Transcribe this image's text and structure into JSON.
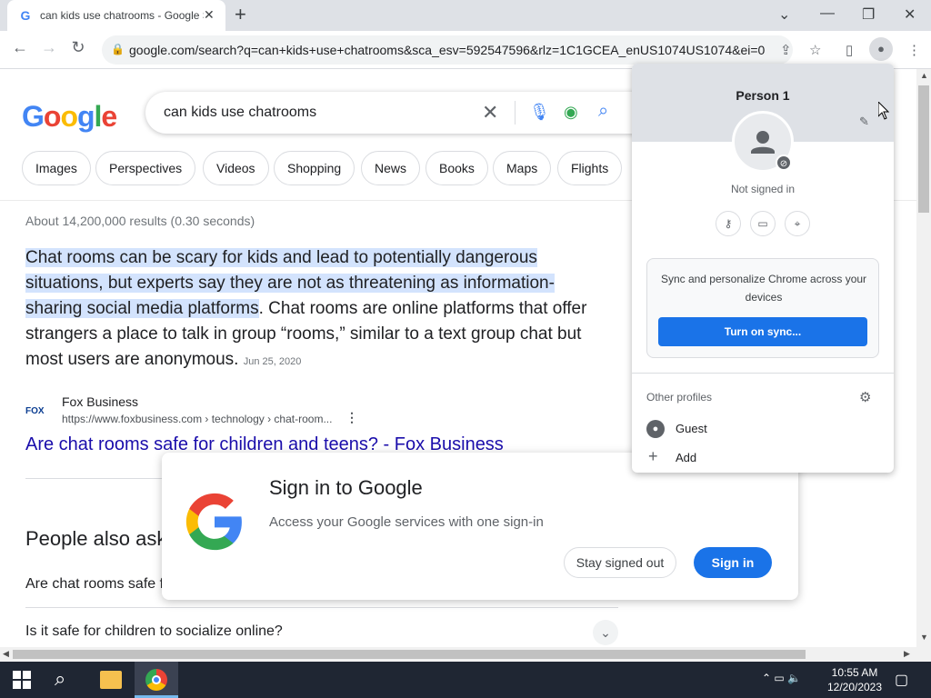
{
  "browser": {
    "tab_title": "can kids use chatrooms - Google Search",
    "tab_favicon": "G",
    "new_tab": "+",
    "url": "google.com/search?q=can+kids+use+chatrooms&sca_esv=592547596&rlz=1C1GCEA_enUS1074US1074&ei=0..."
  },
  "search": {
    "logo": "Google",
    "query": "can kids use chatrooms",
    "chips": [
      "Images",
      "Perspectives",
      "Videos",
      "Shopping",
      "News",
      "Books",
      "Maps",
      "Flights"
    ]
  },
  "results": {
    "stats": "About 14,200,000 results (0.30 seconds)",
    "snippet_highlight": "Chat rooms can be scary for kids and lead to potentially dangerous situations, but experts say they are not as threatening as information-sharing social media platforms",
    "snippet_rest": ". Chat rooms are online platforms that offer strangers a place to talk in group “rooms,” similar to a text group chat but most users are anonymous.",
    "snippet_date": "Jun 25, 2020",
    "source_icon": "FOX",
    "source_name": "Fox Business",
    "source_url": "https://www.foxbusiness.com › technology › chat-room...",
    "result_title": "Are chat rooms safe for children and teens? - Fox Business",
    "paa_heading": "People also ask",
    "paa_q1": "Are chat rooms safe for kids?",
    "paa_q2": "Is it safe for children to socialize online?"
  },
  "signin_popup": {
    "title": "Sign in to Google",
    "subtitle": "Access your Google services with one sign-in",
    "stay_signed_out": "Stay signed out",
    "sign_in": "Sign in"
  },
  "profile_menu": {
    "name": "Person 1",
    "status": "Not signed in",
    "sync_text": "Sync and personalize Chrome across your devices",
    "sync_button": "Turn on sync...",
    "other_profiles": "Other profiles",
    "guest": "Guest",
    "add": "Add"
  },
  "taskbar": {
    "time": "10:55 AM",
    "date": "12/20/2023"
  },
  "colors": {
    "accent": "#1a73e8",
    "link": "#1a0dab",
    "highlight": "#d3e3fd"
  }
}
